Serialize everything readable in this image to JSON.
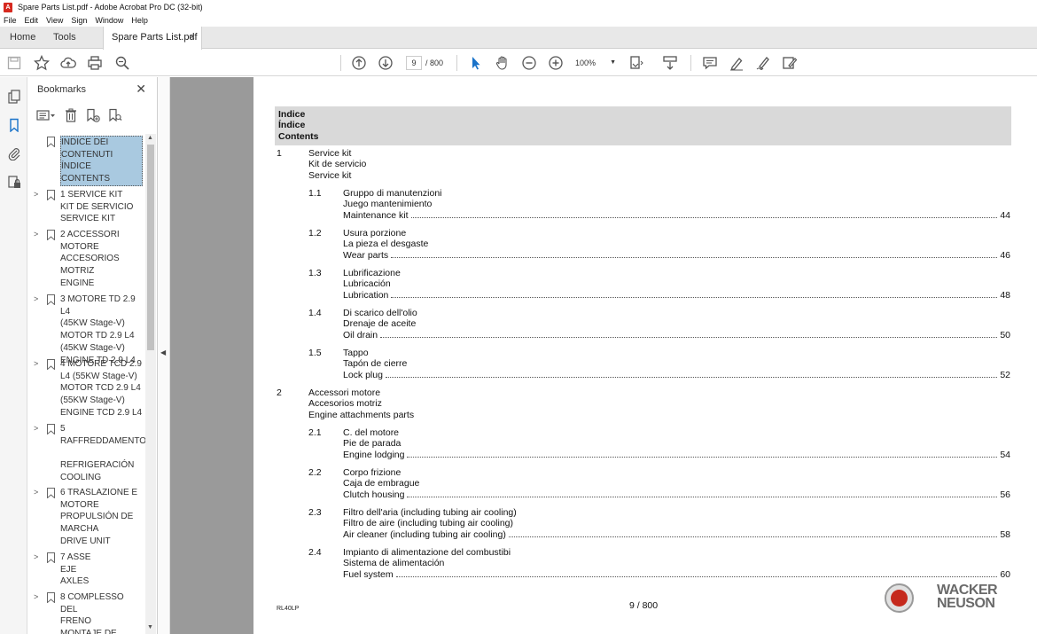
{
  "window": {
    "title": "Spare Parts List.pdf - Adobe Acrobat Pro DC (32-bit)"
  },
  "menu": [
    "File",
    "Edit",
    "View",
    "Sign",
    "Window",
    "Help"
  ],
  "tabs": {
    "home": "Home",
    "tools": "Tools",
    "document": "Spare Parts List.pdf",
    "close": "×"
  },
  "toolbar": {
    "page_current": "9",
    "page_total": "/ 800",
    "zoom": "100%"
  },
  "bookmarks": {
    "title": "Bookmarks",
    "close": "✕",
    "items": [
      {
        "label": "INDICE DEI\nCONTENUTI\nÍNDICE\nCONTENTS",
        "expandable": false,
        "selected": true
      },
      {
        "label": "1 SERVICE KIT\nKIT DE SERVICIO\nSERVICE KIT",
        "expandable": true
      },
      {
        "label": "2 ACCESSORI\nMOTORE\nACCESORIOS\nMOTRIZ\nENGINE",
        "expandable": true
      },
      {
        "label": "3 MOTORE TD 2.9 L4\n(45KW Stage-V)\nMOTOR TD 2.9 L4\n(45KW Stage-V)\nENGINE TD 2.9 L4",
        "expandable": true
      },
      {
        "label": "4 MOTORE TCD 2.9\nL4 (55KW Stage-V)\nMOTOR TCD 2.9 L4\n(55KW Stage-V)\nENGINE TCD 2.9 L4",
        "expandable": true
      },
      {
        "label": "5\nRAFFREDDAMENTO\n\nREFRIGERACIÓN\nCOOLING",
        "expandable": true
      },
      {
        "label": "6 TRASLAZIONE E\nMOTORE\nPROPULSIÓN DE\nMARCHA\nDRIVE UNIT",
        "expandable": true
      },
      {
        "label": "7 ASSE\nEJE\nAXLES",
        "expandable": true
      },
      {
        "label": "8 COMPLESSO DEL\nFRENO\nMONTAJE DE",
        "expandable": true
      }
    ]
  },
  "document": {
    "header": [
      "Indice",
      "Índice",
      "Contents"
    ],
    "sections": [
      {
        "num": "1",
        "lines": "Service kit\nKit de servicio\nService kit",
        "subs": [
          {
            "num": "1.1",
            "lines": "Gruppo di manutenzioni\nJuego mantenimiento",
            "last": "Maintenance kit",
            "page": "44"
          },
          {
            "num": "1.2",
            "lines": "Usura porzione\nLa pieza el desgaste",
            "last": "Wear parts",
            "page": "46"
          },
          {
            "num": "1.3",
            "lines": "Lubrificazione\nLubricación",
            "last": "Lubrication",
            "page": "48"
          },
          {
            "num": "1.4",
            "lines": "Di scarico dell'olio\nDrenaje de aceite",
            "last": "Oil drain",
            "page": "50"
          },
          {
            "num": "1.5",
            "lines": "Tappo\nTapón de cierre",
            "last": "Lock plug",
            "page": "52"
          }
        ]
      },
      {
        "num": "2",
        "lines": "Accessori motore\nAccesorios motriz\nEngine attachments parts",
        "subs": [
          {
            "num": "2.1",
            "lines": "C. del motore\nPie de parada",
            "last": "Engine lodging",
            "page": "54"
          },
          {
            "num": "2.2",
            "lines": "Corpo frizione\nCaja de embrague",
            "last": "Clutch housing",
            "page": "56"
          },
          {
            "num": "2.3",
            "lines": "Filtro dell'aria (including tubing air cooling)\nFiltro de aire (including tubing air cooling)",
            "last": "Air cleaner (including tubing air cooling)",
            "page": "58"
          },
          {
            "num": "2.4",
            "lines": "Impianto di alimentazione del combustibi\nSistema de alimentación",
            "last": "Fuel system",
            "page": "60"
          }
        ]
      }
    ],
    "footer_left": "RL40LP",
    "footer_page": "9 / 800",
    "logo_text": "WACKER\nNEUSON"
  },
  "colors": {
    "selected_bookmark": "#a9c9e0",
    "page_gray": "#9a9a9a",
    "header_box": "#d9d9d9",
    "logo_red": "#c5291c"
  }
}
